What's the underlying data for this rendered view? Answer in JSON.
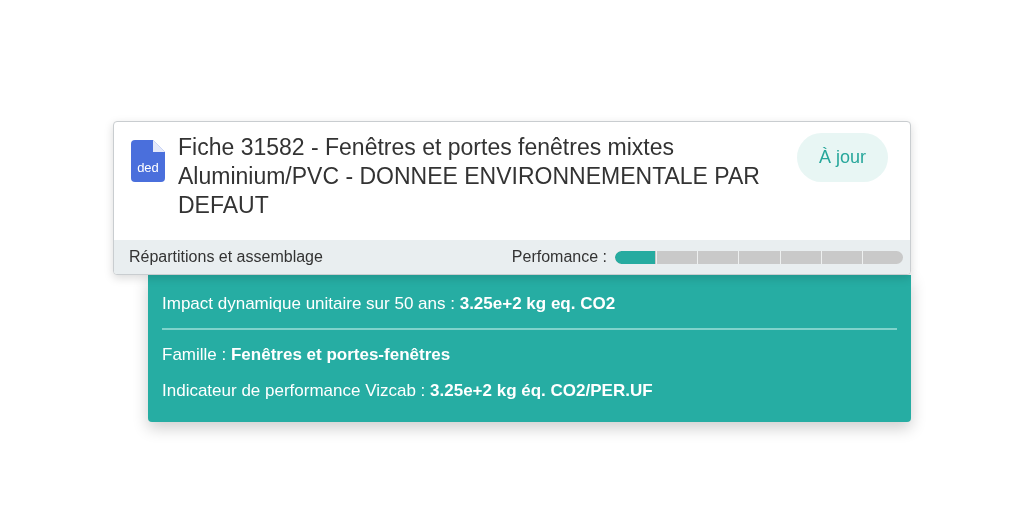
{
  "card": {
    "file_icon_label": "ded",
    "title": "Fiche 31582 - Fenêtres et portes fenêtres mixtes Aluminium/PVC - DONNEE ENVIRONNEMENTALE PAR DEFAUT",
    "status": "À jour",
    "footer_label": "Répartitions et assemblage",
    "performance_label": "Perfomance :",
    "performance": {
      "level": 0.14
    }
  },
  "details": [
    {
      "text": "Impact dynamique unitaire sur 50 ans : **3.25e+2 kg eq. CO2**",
      "divider_after": true
    },
    {
      "text": "Famille : **Fenêtres et portes-fenêtres**",
      "divider_after": false
    },
    {
      "text": "Indicateur de performance Vizcab :  **3.25e+2 kg éq. CO2/PER.UF**",
      "divider_after": false
    }
  ]
}
